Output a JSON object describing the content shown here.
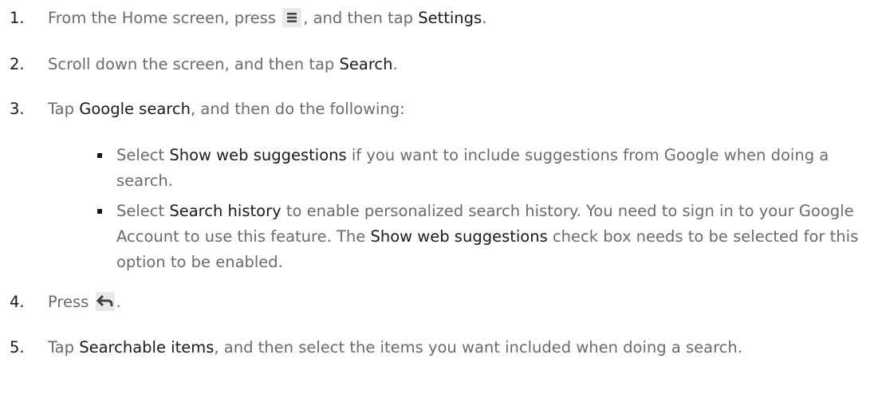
{
  "steps": [
    {
      "num": "1.",
      "before": "From the Home screen, press ",
      "mid": ", and then tap ",
      "hl1": "Settings",
      "after": "."
    },
    {
      "num": "2.",
      "before": "Scroll down the screen, and then tap ",
      "hl1": "Search",
      "after": "."
    },
    {
      "num": "3.",
      "before": "Tap ",
      "hl1": "Google search",
      "after": ", and then do the following:"
    },
    {
      "num": "4.",
      "before": "Press ",
      "after": "."
    },
    {
      "num": "5.",
      "before": "Tap ",
      "hl1": "Searchable items",
      "after": ", and then select the items you want included when doing a search."
    }
  ],
  "bullets": [
    {
      "before": "Select ",
      "hl1": "Show web suggestions",
      "after": " if you want to include suggestions from Google when doing a search."
    },
    {
      "before": "Select ",
      "hl1": "Search history",
      "mid": " to enable personalized search history. You need to sign in to your Google Account to use this feature. The ",
      "hl2": "Show web suggestions",
      "after": " check box needs to be selected for this option to be enabled."
    }
  ],
  "icons": {
    "menu": "menu-icon",
    "back": "back-arrow-icon"
  }
}
